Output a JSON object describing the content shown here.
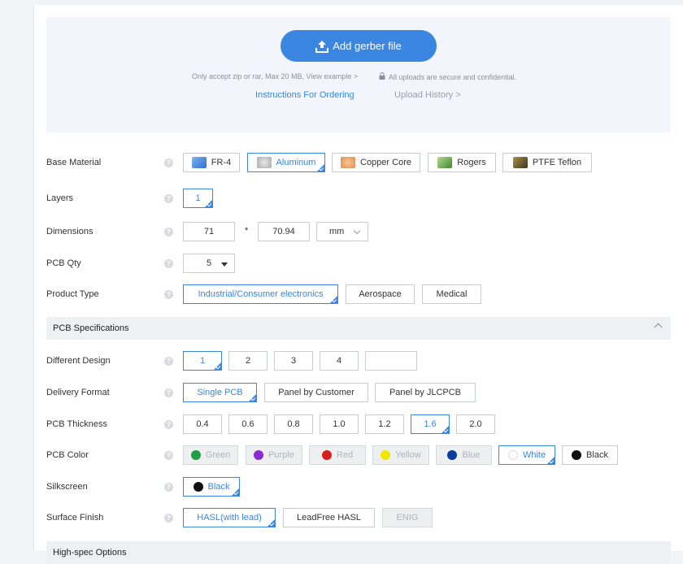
{
  "upload": {
    "button_label": "Add gerber file",
    "hint": "Only accept zip or rar, Max 20 MB, View example >",
    "secure_note": "All uploads are secure and confidential.",
    "instructions_link": "Instructions For Ordering",
    "history_link": "Upload History >"
  },
  "base_material": {
    "label": "Base Material",
    "options": [
      "FR-4",
      "Aluminum",
      "Copper Core",
      "Rogers",
      "PTFE Teflon"
    ],
    "selected": "Aluminum"
  },
  "layers": {
    "label": "Layers",
    "value": "1"
  },
  "dimensions": {
    "label": "Dimensions",
    "width": "71",
    "separator": "*",
    "height": "70.94",
    "unit": "mm"
  },
  "pcb_qty": {
    "label": "PCB Qty",
    "value": "5"
  },
  "product_type": {
    "label": "Product Type",
    "options": [
      "Industrial/Consumer electronics",
      "Aerospace",
      "Medical"
    ],
    "selected": "Industrial/Consumer electronics"
  },
  "pcb_specs": {
    "title": "PCB Specifications"
  },
  "different_design": {
    "label": "Different Design",
    "options": [
      "1",
      "2",
      "3",
      "4"
    ],
    "custom_value": "",
    "selected": "1"
  },
  "delivery_format": {
    "label": "Delivery Format",
    "options": [
      "Single PCB",
      "Panel by Customer",
      "Panel by JLCPCB"
    ],
    "selected": "Single PCB"
  },
  "pcb_thickness": {
    "label": "PCB Thickness",
    "options": [
      "0.4",
      "0.6",
      "0.8",
      "1.0",
      "1.2",
      "1.6",
      "2.0"
    ],
    "selected": "1.6"
  },
  "pcb_color": {
    "label": "PCB Color",
    "options": [
      {
        "name": "Green",
        "color": "#1f9e4a"
      },
      {
        "name": "Purple",
        "color": "#8a2bd4"
      },
      {
        "name": "Red",
        "color": "#d81e1e"
      },
      {
        "name": "Yellow",
        "color": "#f3e600"
      },
      {
        "name": "Blue",
        "color": "#0b3d9a"
      },
      {
        "name": "White",
        "color": "#ffffff"
      },
      {
        "name": "Black",
        "color": "#111111"
      }
    ],
    "selected": "White"
  },
  "silkscreen": {
    "label": "Silkscreen",
    "value": "Black",
    "color": "#111111"
  },
  "surface_finish": {
    "label": "Surface Finish",
    "options": [
      "HASL(with lead)",
      "LeadFree HASL",
      "ENIG"
    ],
    "selected": "HASL(with lead)"
  },
  "high_spec": {
    "title": "High-spec Options"
  },
  "colors": {
    "accent": "#3a86e0",
    "upload_bg": "#f2f6fc"
  }
}
